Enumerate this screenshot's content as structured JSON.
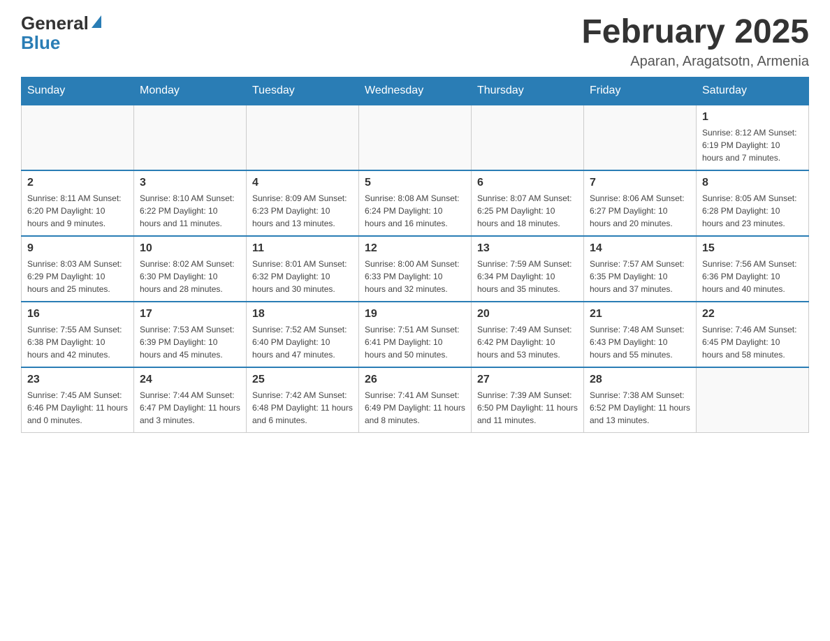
{
  "header": {
    "logo_general": "General",
    "logo_blue": "Blue",
    "title": "February 2025",
    "subtitle": "Aparan, Aragatsotn, Armenia"
  },
  "days_of_week": [
    "Sunday",
    "Monday",
    "Tuesday",
    "Wednesday",
    "Thursday",
    "Friday",
    "Saturday"
  ],
  "weeks": [
    [
      {
        "day": "",
        "info": ""
      },
      {
        "day": "",
        "info": ""
      },
      {
        "day": "",
        "info": ""
      },
      {
        "day": "",
        "info": ""
      },
      {
        "day": "",
        "info": ""
      },
      {
        "day": "",
        "info": ""
      },
      {
        "day": "1",
        "info": "Sunrise: 8:12 AM\nSunset: 6:19 PM\nDaylight: 10 hours and 7 minutes."
      }
    ],
    [
      {
        "day": "2",
        "info": "Sunrise: 8:11 AM\nSunset: 6:20 PM\nDaylight: 10 hours and 9 minutes."
      },
      {
        "day": "3",
        "info": "Sunrise: 8:10 AM\nSunset: 6:22 PM\nDaylight: 10 hours and 11 minutes."
      },
      {
        "day": "4",
        "info": "Sunrise: 8:09 AM\nSunset: 6:23 PM\nDaylight: 10 hours and 13 minutes."
      },
      {
        "day": "5",
        "info": "Sunrise: 8:08 AM\nSunset: 6:24 PM\nDaylight: 10 hours and 16 minutes."
      },
      {
        "day": "6",
        "info": "Sunrise: 8:07 AM\nSunset: 6:25 PM\nDaylight: 10 hours and 18 minutes."
      },
      {
        "day": "7",
        "info": "Sunrise: 8:06 AM\nSunset: 6:27 PM\nDaylight: 10 hours and 20 minutes."
      },
      {
        "day": "8",
        "info": "Sunrise: 8:05 AM\nSunset: 6:28 PM\nDaylight: 10 hours and 23 minutes."
      }
    ],
    [
      {
        "day": "9",
        "info": "Sunrise: 8:03 AM\nSunset: 6:29 PM\nDaylight: 10 hours and 25 minutes."
      },
      {
        "day": "10",
        "info": "Sunrise: 8:02 AM\nSunset: 6:30 PM\nDaylight: 10 hours and 28 minutes."
      },
      {
        "day": "11",
        "info": "Sunrise: 8:01 AM\nSunset: 6:32 PM\nDaylight: 10 hours and 30 minutes."
      },
      {
        "day": "12",
        "info": "Sunrise: 8:00 AM\nSunset: 6:33 PM\nDaylight: 10 hours and 32 minutes."
      },
      {
        "day": "13",
        "info": "Sunrise: 7:59 AM\nSunset: 6:34 PM\nDaylight: 10 hours and 35 minutes."
      },
      {
        "day": "14",
        "info": "Sunrise: 7:57 AM\nSunset: 6:35 PM\nDaylight: 10 hours and 37 minutes."
      },
      {
        "day": "15",
        "info": "Sunrise: 7:56 AM\nSunset: 6:36 PM\nDaylight: 10 hours and 40 minutes."
      }
    ],
    [
      {
        "day": "16",
        "info": "Sunrise: 7:55 AM\nSunset: 6:38 PM\nDaylight: 10 hours and 42 minutes."
      },
      {
        "day": "17",
        "info": "Sunrise: 7:53 AM\nSunset: 6:39 PM\nDaylight: 10 hours and 45 minutes."
      },
      {
        "day": "18",
        "info": "Sunrise: 7:52 AM\nSunset: 6:40 PM\nDaylight: 10 hours and 47 minutes."
      },
      {
        "day": "19",
        "info": "Sunrise: 7:51 AM\nSunset: 6:41 PM\nDaylight: 10 hours and 50 minutes."
      },
      {
        "day": "20",
        "info": "Sunrise: 7:49 AM\nSunset: 6:42 PM\nDaylight: 10 hours and 53 minutes."
      },
      {
        "day": "21",
        "info": "Sunrise: 7:48 AM\nSunset: 6:43 PM\nDaylight: 10 hours and 55 minutes."
      },
      {
        "day": "22",
        "info": "Sunrise: 7:46 AM\nSunset: 6:45 PM\nDaylight: 10 hours and 58 minutes."
      }
    ],
    [
      {
        "day": "23",
        "info": "Sunrise: 7:45 AM\nSunset: 6:46 PM\nDaylight: 11 hours and 0 minutes."
      },
      {
        "day": "24",
        "info": "Sunrise: 7:44 AM\nSunset: 6:47 PM\nDaylight: 11 hours and 3 minutes."
      },
      {
        "day": "25",
        "info": "Sunrise: 7:42 AM\nSunset: 6:48 PM\nDaylight: 11 hours and 6 minutes."
      },
      {
        "day": "26",
        "info": "Sunrise: 7:41 AM\nSunset: 6:49 PM\nDaylight: 11 hours and 8 minutes."
      },
      {
        "day": "27",
        "info": "Sunrise: 7:39 AM\nSunset: 6:50 PM\nDaylight: 11 hours and 11 minutes."
      },
      {
        "day": "28",
        "info": "Sunrise: 7:38 AM\nSunset: 6:52 PM\nDaylight: 11 hours and 13 minutes."
      },
      {
        "day": "",
        "info": ""
      }
    ]
  ]
}
